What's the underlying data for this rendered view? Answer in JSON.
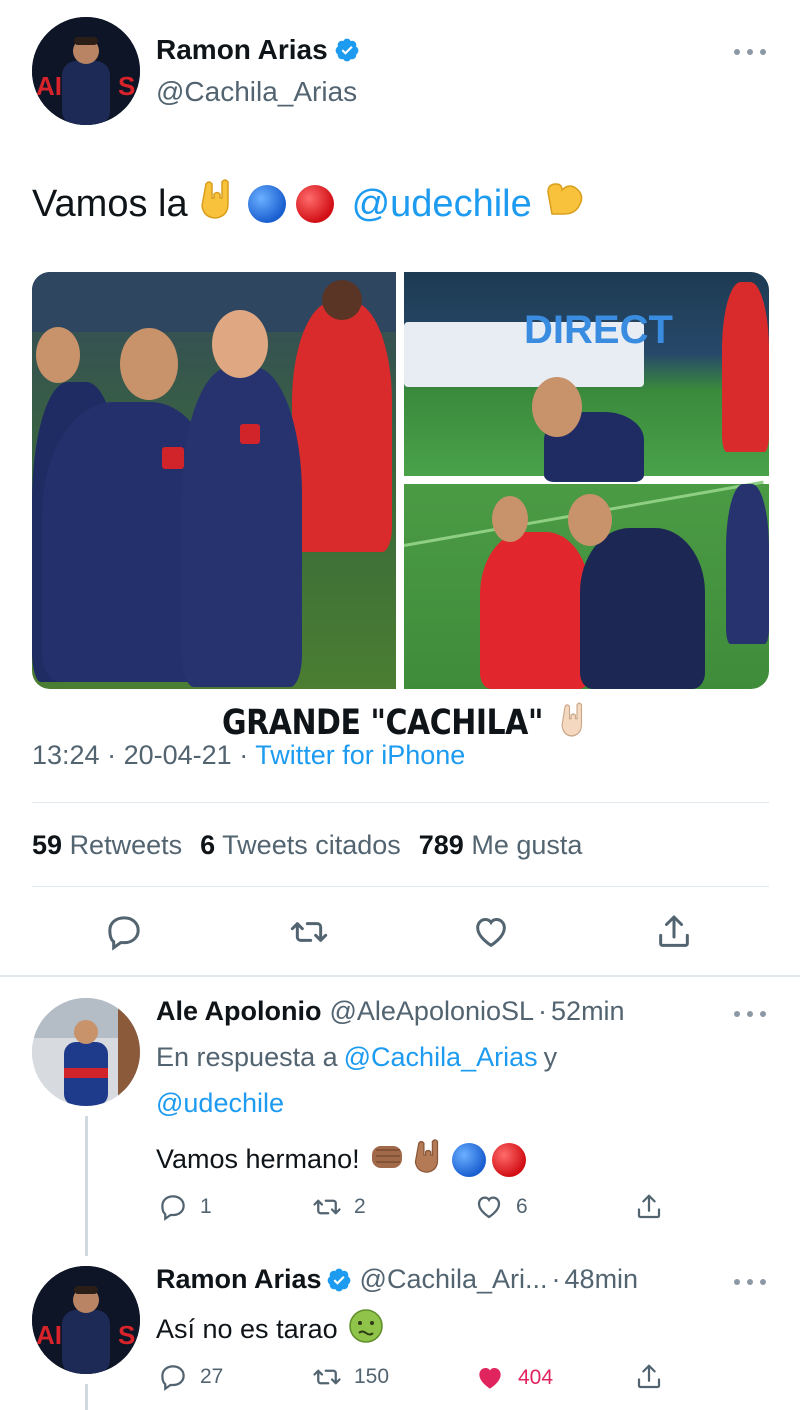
{
  "main_tweet": {
    "author_name": "Ramon Arias",
    "author_handle": "@Cachila_Arias",
    "text_prefix": "Vamos la",
    "mention": "@udechile",
    "caption": "GRANDE \"CACHILA\"",
    "time": "13:24",
    "date": "20-04-21",
    "source": "Twitter for iPhone",
    "meta_sep": "·",
    "stats": {
      "retweets_count": "59",
      "retweets_label": "Retweets",
      "quotes_count": "6",
      "quotes_label": "Tweets citados",
      "likes_count": "789",
      "likes_label": "Me gusta"
    }
  },
  "replies": [
    {
      "name": "Ale Apolonio",
      "handle": "@AleApolonioSL",
      "time": "52min",
      "reply_to_prefix": "En respuesta a",
      "reply_to_1": "@Cachila_Arias",
      "reply_to_joiner": "y",
      "reply_to_2": "@udechile",
      "text": "Vamos hermano!",
      "replies": "1",
      "retweets": "2",
      "likes": "6"
    },
    {
      "name": "Ramon Arias",
      "handle": "@Cachila_Ari...",
      "time": "48min",
      "text": "Así no es tarao",
      "replies": "27",
      "retweets": "150",
      "likes": "404"
    }
  ],
  "colors": {
    "accent": "#1d9bf0",
    "like_active": "#e0245e",
    "secondary_text": "#536471"
  },
  "icons": [
    "verified-badge-icon",
    "more-options-icon",
    "reply-icon",
    "retweet-icon",
    "like-icon",
    "share-icon",
    "rock-hand-emoji",
    "flexed-bicep-emoji",
    "blue-circle-emoji",
    "red-circle-emoji",
    "oncoming-fist-emoji",
    "nauseated-face-emoji"
  ]
}
